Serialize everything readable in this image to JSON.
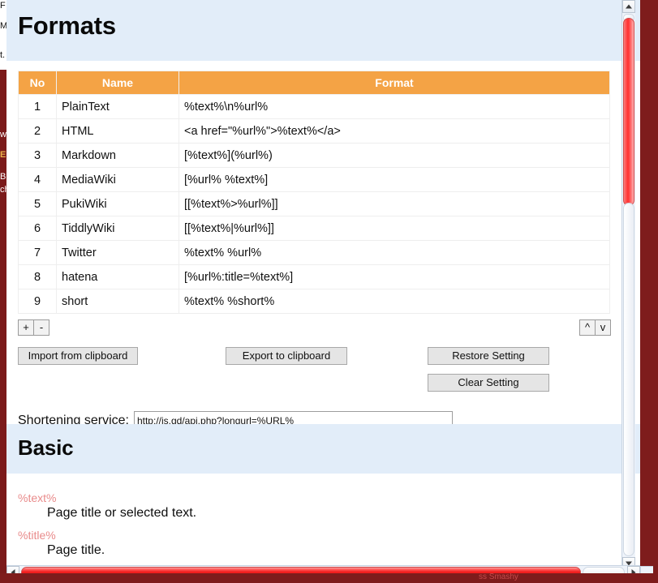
{
  "window": {
    "backdrop_color": "#7e1c1c",
    "page_background": "#ffffff"
  },
  "left_edge_fragments": {
    "frag1": "F",
    "frag2": "M",
    "frag3": "t.",
    "frag4": "w",
    "frag5": "E",
    "frag6": "B",
    "frag7": "ch"
  },
  "sections": {
    "formats": {
      "heading": "Formats",
      "heading_background": "#e2edf9",
      "table": {
        "header_background": "#f4a345",
        "columns": [
          "No",
          "Name",
          "Format"
        ],
        "rows": [
          {
            "no": "1",
            "name": "PlainText",
            "format": "%text%\\n%url%"
          },
          {
            "no": "2",
            "name": "HTML",
            "format": "<a href=\"%url%\">%text%</a>"
          },
          {
            "no": "3",
            "name": "Markdown",
            "format": "[%text%](%url%)"
          },
          {
            "no": "4",
            "name": "MediaWiki",
            "format": "[%url% %text%]"
          },
          {
            "no": "5",
            "name": "PukiWiki",
            "format": "[[%text%>%url%]]"
          },
          {
            "no": "6",
            "name": "TiddlyWiki",
            "format": "[[%text%|%url%]]"
          },
          {
            "no": "7",
            "name": "Twitter",
            "format": "%text% %url%"
          },
          {
            "no": "8",
            "name": "hatena",
            "format": "[%url%:title=%text%]"
          },
          {
            "no": "9",
            "name": "short",
            "format": "%text% %short%"
          }
        ]
      },
      "row_controls": {
        "add_label": "+",
        "remove_label": "-",
        "move_up_label": "^",
        "move_down_label": "v"
      },
      "buttons": {
        "import": "Import from clipboard",
        "export": "Export to clipboard",
        "restore": "Restore Setting",
        "clear": "Clear Setting"
      },
      "shortening_service": {
        "label": "Shortening service:",
        "value": "http://is.gd/api.php?longurl=%URL%"
      }
    },
    "basic": {
      "heading": "Basic",
      "definitions": [
        {
          "term": "%text%",
          "description": "Page title or selected text."
        },
        {
          "term": "%title%",
          "description": "Page title."
        }
      ],
      "term_color": "#e98b8b"
    }
  },
  "scrollbars": {
    "vertical": {
      "up_arrow": "▲",
      "down_arrow": "▼",
      "thumb_color": "#ff2f2f"
    },
    "horizontal": {
      "left_arrow": "◀",
      "right_arrow": "▶",
      "thumb_color": "#f01414"
    }
  },
  "footer": {
    "watermark": "ss Smashy"
  }
}
